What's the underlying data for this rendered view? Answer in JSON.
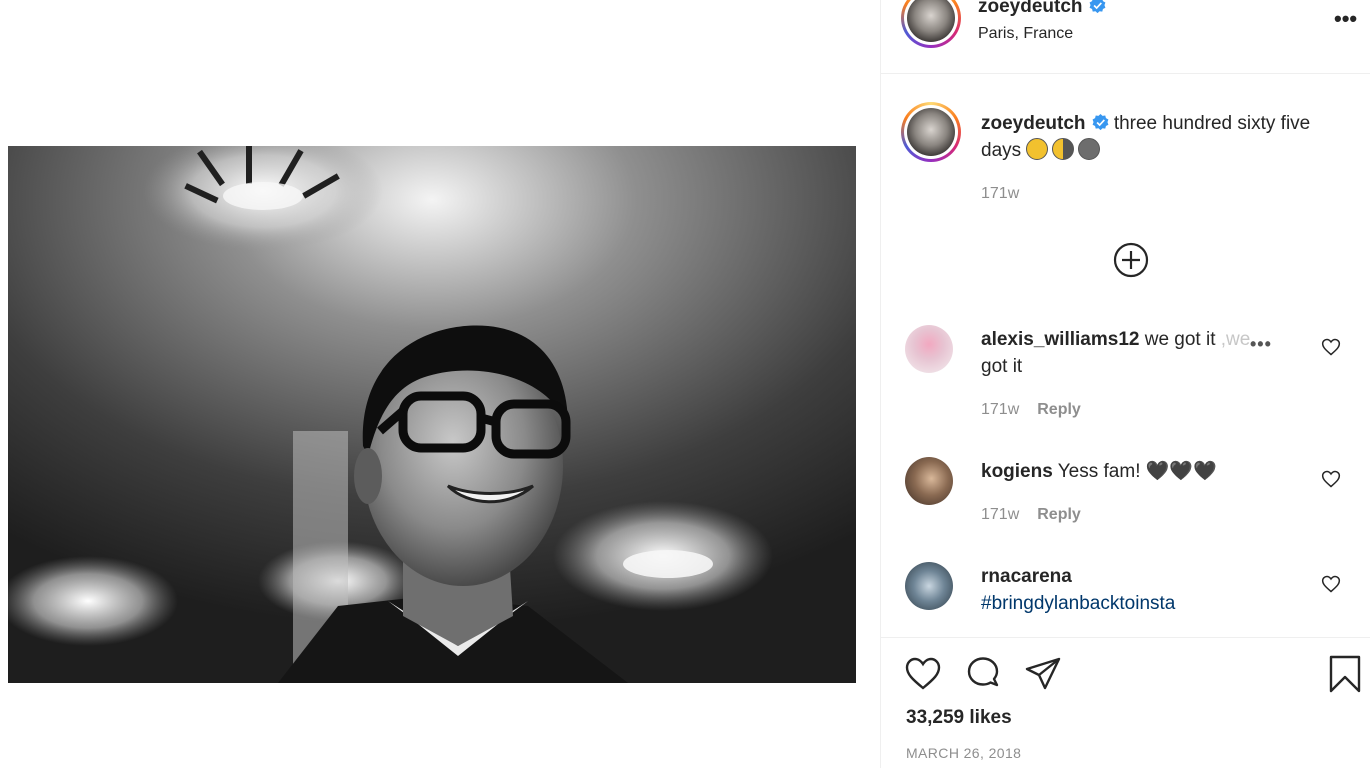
{
  "post": {
    "username": "zoeydeutch",
    "location": "Paris, France",
    "more_label": "•••"
  },
  "caption": {
    "username": "zoeydeutch",
    "text": "three hundred sixty five days",
    "emojis": [
      "full-moon-emoji",
      "half-moon-emoji",
      "new-moon-emoji"
    ],
    "age": "171w"
  },
  "comments": [
    {
      "username": "alexis_williams12",
      "text": "we got it",
      "text_faded": ",we",
      "text_cont": "got it",
      "age": "171w",
      "reply_label": "Reply",
      "more_label": "•••"
    },
    {
      "username": "kogiens",
      "text": "Yess fam! 🖤🖤🖤",
      "age": "171w",
      "reply_label": "Reply"
    },
    {
      "username": "rnacarena",
      "text": "#bringdylanbacktoinsta"
    }
  ],
  "footer": {
    "likes": "33,259 likes",
    "date": "MARCH 26, 2018"
  },
  "colors": {
    "text": "#262626",
    "muted": "#8e8e8e",
    "verified_blue": "#3897f0",
    "hashtag": "#00376b"
  }
}
